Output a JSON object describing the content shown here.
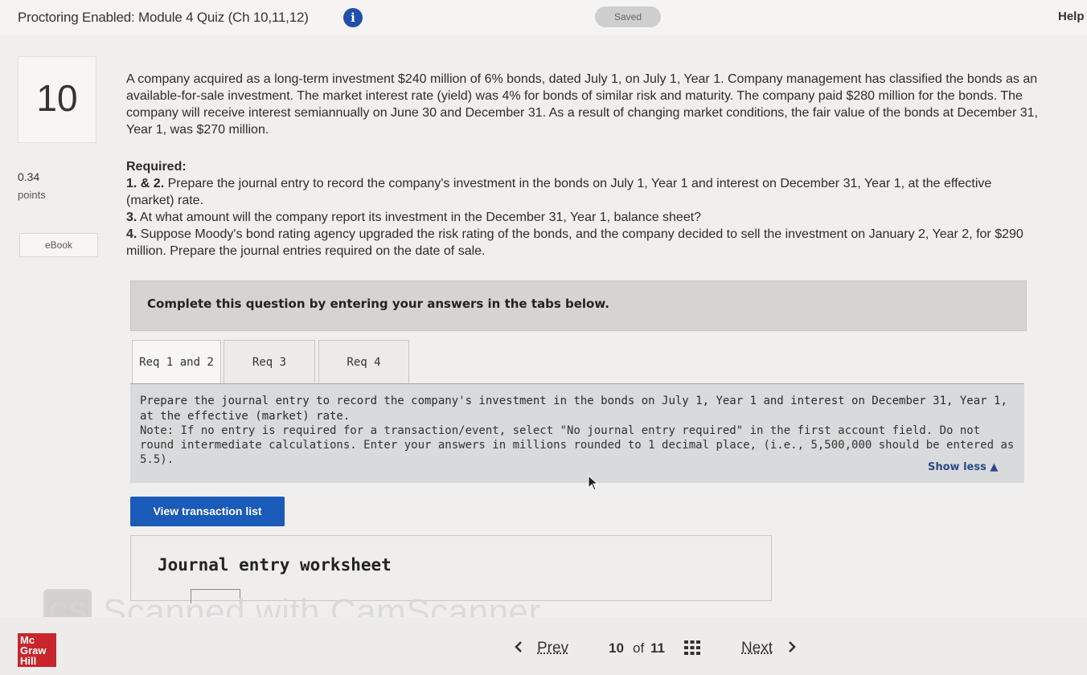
{
  "header": {
    "title": "Proctoring Enabled: Module 4 Quiz (Ch 10,11,12)",
    "info_icon": "info-icon",
    "saved_label": "Saved",
    "help_label": "Help"
  },
  "sidebar": {
    "question_number": "10",
    "points_value": "0.34",
    "points_label": "points",
    "ebook_label": "eBook"
  },
  "question": {
    "text": "A company acquired as a long-term investment $240 million of 6% bonds, dated July 1, on July 1, Year 1. Company management has classified the bonds as an available-for-sale investment. The market interest rate (yield) was 4% for bonds of similar risk and maturity. The company paid $280 million for the bonds. The company will receive interest semiannually on June 30 and December 31. As a result of changing market conditions, the fair value of the bonds at December 31, Year 1, was $270 million.",
    "required_label": "Required:",
    "requirements": [
      {
        "num": "1. & 2.",
        "text": " Prepare the journal entry to record the company's investment in the bonds on July 1, Year 1 and interest on December 31, Year 1, at the effective (market) rate."
      },
      {
        "num": "3.",
        "text": " At what amount will the company report its investment in the December 31, Year 1, balance sheet?"
      },
      {
        "num": "4.",
        "text": " Suppose Moody's bond rating agency upgraded the risk rating of the bonds, and the company decided to sell the investment on January 2, Year 2, for $290 million. Prepare the journal entries required on the date of sale."
      }
    ]
  },
  "instructions": "Complete this question by entering your answers in the tabs below.",
  "tabs": [
    {
      "label": "Req 1 and 2"
    },
    {
      "label": "Req 3"
    },
    {
      "label": "Req 4"
    }
  ],
  "panel": {
    "main": "Prepare the journal entry to record the company's investment in the bonds on July 1, Year 1 and interest on December 31, Year 1, at the effective (market) rate.",
    "note": "Note: If no entry is required for a transaction/event, select \"No journal entry required\" in the first account field. Do not round intermediate calculations. Enter your answers in millions rounded to 1 decimal place, (i.e., 5,500,000 should be entered as 5.5).",
    "show_less": "Show less ▲"
  },
  "view_transaction_list": "View transaction list",
  "worksheet_title": "Journal entry worksheet",
  "watermark": {
    "logo": "CS",
    "text": "Scanned with CamScanner"
  },
  "footer": {
    "logo_lines": [
      "Mc",
      "Graw",
      "Hill"
    ],
    "prev_label": "Prev",
    "current_page": "10",
    "of_label": "of",
    "total_pages": "11",
    "next_label": "Next"
  },
  "colors": {
    "accent_blue": "#1a5ab8",
    "info_blue": "#1f4fa8",
    "mgh_red": "#c8262c",
    "banner_gray": "#d6d4d2",
    "panel_gray": "#d9dadb"
  }
}
